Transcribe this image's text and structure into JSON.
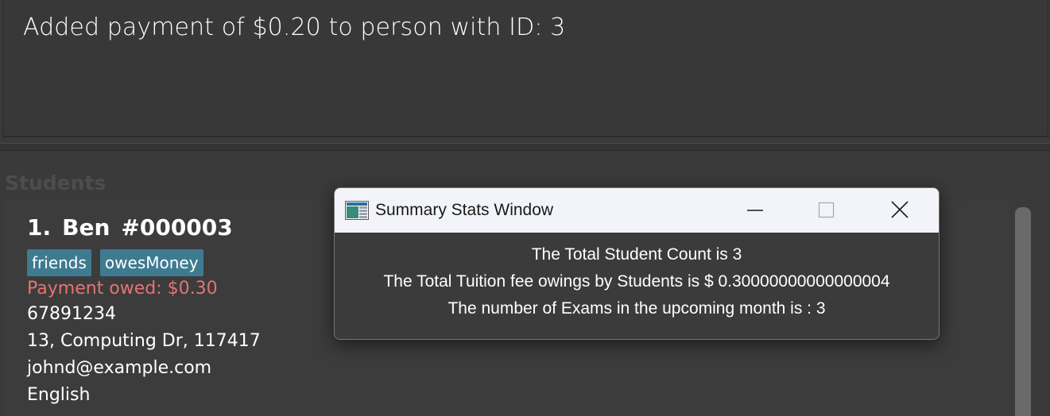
{
  "result_display": {
    "message": "Added payment of $0.20 to person with ID: 3"
  },
  "student_list": {
    "header": "Students",
    "cards": [
      {
        "index": "1.",
        "name": "Ben",
        "student_id": "#000003",
        "tags": [
          "friends",
          "owesMoney"
        ],
        "payment_owed": "Payment owed: $0.30",
        "phone": "67891234",
        "address": "13, Computing Dr, 117417",
        "email": "johnd@example.com",
        "subject": "English"
      }
    ]
  },
  "summary_window": {
    "title": "Summary Stats Window",
    "app_icon": "window-app-icon",
    "controls": {
      "minimize_icon": "minimize-icon",
      "maximize_icon": "maximize-icon",
      "close_icon": "close-icon"
    },
    "stats": {
      "student_count": "The Total Student Count is 3",
      "tuition_owings": "The Total Tuition fee owings by Students is $ 0.30000000000000004",
      "upcoming_exams": "The number of Exams in the upcoming month is : 3"
    }
  },
  "colors": {
    "background": "#3a3a3a",
    "tag_background": "#3e7b91",
    "owed_text": "#e57373",
    "titlebar": "#f3f4f9"
  }
}
